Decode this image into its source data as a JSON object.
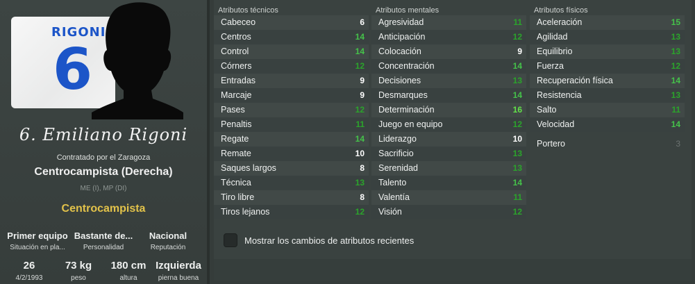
{
  "player": {
    "shirt_name": "RIGONI",
    "shirt_number": "6",
    "display_name": "6. Emiliano Rigoni",
    "contract": "Contratado por el Zaragoza",
    "position_full": "Centrocampista (Derecha)",
    "positions_short": "ME (I), MP (DI)",
    "role": "Centrocampista",
    "info": [
      {
        "value": "Primer equipo",
        "label": "Situación en pla..."
      },
      {
        "value": "Bastante de...",
        "label": "Personalidad"
      },
      {
        "value": "Nacional",
        "label": "Reputación"
      }
    ],
    "stats": [
      {
        "value": "26",
        "label": "4/2/1993"
      },
      {
        "value": "73 kg",
        "label": "peso"
      },
      {
        "value": "180 cm",
        "label": "altura"
      },
      {
        "value": "Izquierda",
        "label": "pierna buena"
      }
    ]
  },
  "attributes": {
    "technical": {
      "header": "Atributos técnicos",
      "rows": [
        {
          "name": "Cabeceo",
          "value": "6",
          "tier": "white"
        },
        {
          "name": "Centros",
          "value": "14",
          "tier": "lgreen"
        },
        {
          "name": "Control",
          "value": "14",
          "tier": "lgreen"
        },
        {
          "name": "Córners",
          "value": "12",
          "tier": "green"
        },
        {
          "name": "Entradas",
          "value": "9",
          "tier": "white"
        },
        {
          "name": "Marcaje",
          "value": "9",
          "tier": "white"
        },
        {
          "name": "Pases",
          "value": "12",
          "tier": "green"
        },
        {
          "name": "Penaltis",
          "value": "11",
          "tier": "green"
        },
        {
          "name": "Regate",
          "value": "14",
          "tier": "lgreen"
        },
        {
          "name": "Remate",
          "value": "10",
          "tier": "white"
        },
        {
          "name": "Saques largos",
          "value": "8",
          "tier": "white"
        },
        {
          "name": "Técnica",
          "value": "13",
          "tier": "green"
        },
        {
          "name": "Tiro libre",
          "value": "8",
          "tier": "white"
        },
        {
          "name": "Tiros lejanos",
          "value": "12",
          "tier": "green"
        }
      ]
    },
    "mental": {
      "header": "Atributos mentales",
      "rows": [
        {
          "name": "Agresividad",
          "value": "11",
          "tier": "green"
        },
        {
          "name": "Anticipación",
          "value": "12",
          "tier": "green"
        },
        {
          "name": "Colocación",
          "value": "9",
          "tier": "white"
        },
        {
          "name": "Concentración",
          "value": "14",
          "tier": "lgreen"
        },
        {
          "name": "Decisiones",
          "value": "13",
          "tier": "green"
        },
        {
          "name": "Desmarques",
          "value": "14",
          "tier": "lgreen"
        },
        {
          "name": "Determinación",
          "value": "16",
          "tier": "bright"
        },
        {
          "name": "Juego en equipo",
          "value": "12",
          "tier": "green"
        },
        {
          "name": "Liderazgo",
          "value": "10",
          "tier": "white"
        },
        {
          "name": "Sacrificio",
          "value": "13",
          "tier": "green"
        },
        {
          "name": "Serenidad",
          "value": "13",
          "tier": "green"
        },
        {
          "name": "Talento",
          "value": "14",
          "tier": "lgreen"
        },
        {
          "name": "Valentía",
          "value": "11",
          "tier": "green"
        },
        {
          "name": "Visión",
          "value": "12",
          "tier": "green"
        }
      ]
    },
    "physical": {
      "header": "Atributos físicos",
      "rows": [
        {
          "name": "Aceleración",
          "value": "15",
          "tier": "lgreen"
        },
        {
          "name": "Agilidad",
          "value": "13",
          "tier": "green"
        },
        {
          "name": "Equilibrio",
          "value": "13",
          "tier": "green"
        },
        {
          "name": "Fuerza",
          "value": "12",
          "tier": "green"
        },
        {
          "name": "Recuperación física",
          "value": "14",
          "tier": "lgreen"
        },
        {
          "name": "Resistencia",
          "value": "13",
          "tier": "green"
        },
        {
          "name": "Salto",
          "value": "11",
          "tier": "green"
        },
        {
          "name": "Velocidad",
          "value": "14",
          "tier": "lgreen"
        }
      ],
      "extra": {
        "name": "Portero",
        "value": "3",
        "tier": "dim"
      }
    }
  },
  "options": {
    "show_changes_label": "Mostrar los cambios de atributos recientes",
    "show_changes_checked": false
  },
  "colors": {
    "shirt_blue": "#1c55c8",
    "role_gold": "#e2c24a",
    "attr_green": "#2ba42b",
    "attr_light_green": "#45c24a",
    "attr_bright_green": "#63e24a"
  }
}
